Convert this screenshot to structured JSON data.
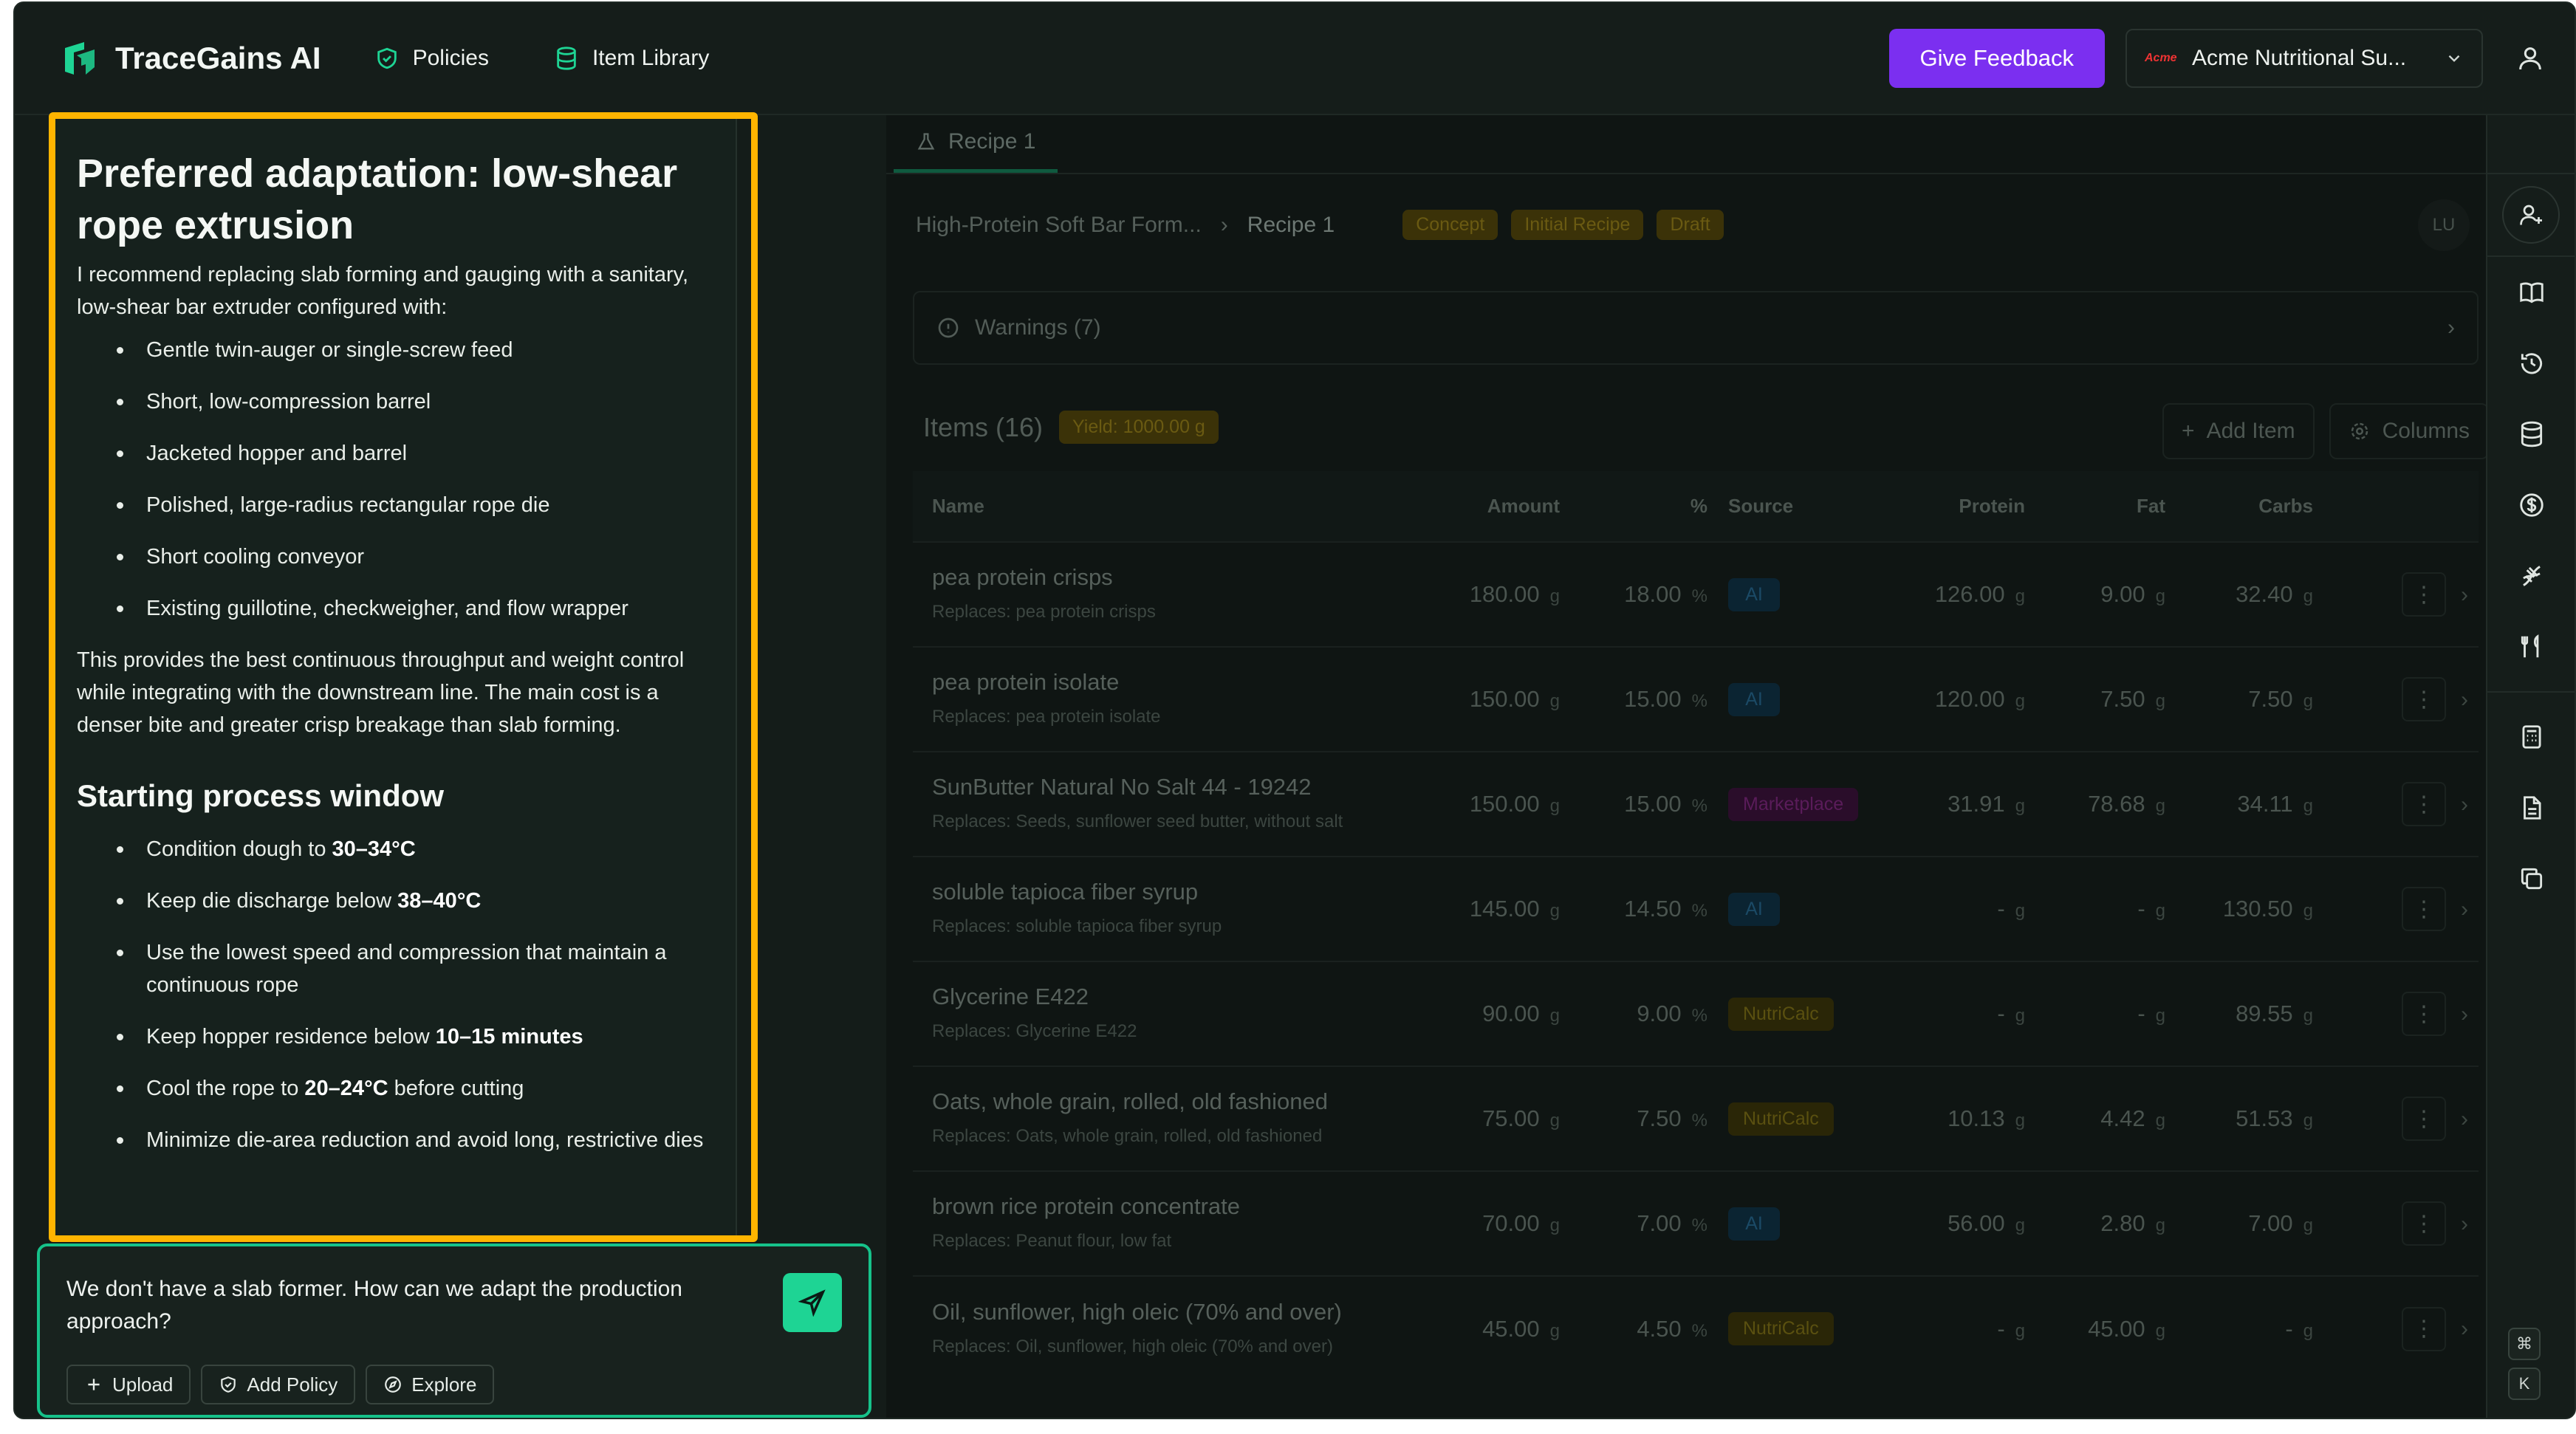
{
  "header": {
    "app_name": "TraceGains AI",
    "nav": [
      {
        "label": "Policies"
      },
      {
        "label": "Item Library"
      }
    ],
    "feedback_label": "Give Feedback",
    "org_logo_text": "Acme",
    "org_name": "Acme Nutritional Su..."
  },
  "chat": {
    "heading1": "Preferred adaptation: low-shear rope extrusion",
    "para1": "I recommend replacing slab forming and gauging with a sanitary, low-shear bar extruder configured with:",
    "bullets1": [
      "Gentle twin-auger or single-screw feed",
      "Short, low-compression barrel",
      "Jacketed hopper and barrel",
      "Polished, large-radius rectangular rope die",
      "Short cooling conveyor",
      "Existing guillotine, checkweigher, and flow wrapper"
    ],
    "para2": "This provides the best continuous throughput and weight control while integrating with the downstream line. The main cost is a denser bite and greater crisp breakage than slab forming.",
    "heading2": "Starting process window",
    "bullets2": [
      {
        "pre": "Condition dough to ",
        "bold": "30–34°C",
        "post": ""
      },
      {
        "pre": "Keep die discharge below ",
        "bold": "38–40°C",
        "post": ""
      },
      {
        "pre": "Use the lowest speed and compression that maintain a continuous rope",
        "bold": "",
        "post": ""
      },
      {
        "pre": "Keep hopper residence below ",
        "bold": "10–15 minutes",
        "post": ""
      },
      {
        "pre": "Cool the rope to ",
        "bold": "20–24°C",
        "post": " before cutting"
      },
      {
        "pre": "Minimize die-area reduction and avoid long, restrictive dies",
        "bold": "",
        "post": ""
      }
    ],
    "input_value": "We don't have a slab former. How can we adapt the production approach?",
    "tools": [
      "Upload",
      "Add Policy",
      "Explore"
    ]
  },
  "recipe": {
    "tab_label": "Recipe 1",
    "breadcrumb_parent": "High-Protein Soft Bar Form...",
    "breadcrumb_current": "Recipe 1",
    "badges": [
      "Concept",
      "Initial Recipe",
      "Draft"
    ],
    "avatar_initials": "LU",
    "warnings_label": "Warnings (7)",
    "items_label": "Items (16)",
    "yield_label": "Yield: 1000.00 g",
    "add_item_label": "Add Item",
    "columns_label": "Columns",
    "columns": [
      "Name",
      "Amount",
      "%",
      "Source",
      "Protein",
      "Fat",
      "Carbs"
    ],
    "rows": [
      {
        "name": "pea protein crisps",
        "replaces": "Replaces: pea protein crisps",
        "amount": "180.00",
        "pct": "18.00",
        "source": "AI",
        "src_type": "ai",
        "protein": "126.00",
        "fat": "9.00",
        "carbs": "32.40"
      },
      {
        "name": "pea protein isolate",
        "replaces": "Replaces: pea protein isolate",
        "amount": "150.00",
        "pct": "15.00",
        "source": "AI",
        "src_type": "ai",
        "protein": "120.00",
        "fat": "7.50",
        "carbs": "7.50"
      },
      {
        "name": "SunButter Natural No Salt 44 - 19242",
        "replaces": "Replaces: Seeds, sunflower seed butter, without salt",
        "amount": "150.00",
        "pct": "15.00",
        "source": "Marketplace",
        "src_type": "mk",
        "protein": "31.91",
        "fat": "78.68",
        "carbs": "34.11"
      },
      {
        "name": "soluble tapioca fiber syrup",
        "replaces": "Replaces: soluble tapioca fiber syrup",
        "amount": "145.00",
        "pct": "14.50",
        "source": "AI",
        "src_type": "ai",
        "protein": "-",
        "fat": "-",
        "carbs": "130.50"
      },
      {
        "name": "Glycerine E422",
        "replaces": "Replaces: Glycerine E422",
        "amount": "90.00",
        "pct": "9.00",
        "source": "NutriCalc",
        "src_type": "nc",
        "protein": "-",
        "fat": "-",
        "carbs": "89.55"
      },
      {
        "name": "Oats, whole grain, rolled, old fashioned",
        "replaces": "Replaces: Oats, whole grain, rolled, old fashioned",
        "amount": "75.00",
        "pct": "7.50",
        "source": "NutriCalc",
        "src_type": "nc",
        "protein": "10.13",
        "fat": "4.42",
        "carbs": "51.53"
      },
      {
        "name": "brown rice protein concentrate",
        "replaces": "Replaces: Peanut flour, low fat",
        "amount": "70.00",
        "pct": "7.00",
        "source": "AI",
        "src_type": "ai",
        "protein": "56.00",
        "fat": "2.80",
        "carbs": "7.00"
      },
      {
        "name": "Oil, sunflower, high oleic (70% and over)",
        "replaces": "Replaces: Oil, sunflower, high oleic (70% and over)",
        "amount": "45.00",
        "pct": "4.50",
        "source": "NutriCalc",
        "src_type": "nc",
        "protein": "-",
        "fat": "45.00",
        "carbs": "-"
      }
    ],
    "unit_g": "g",
    "unit_pct": "%"
  },
  "shortcut": {
    "key1": "⌘",
    "key2": "K"
  },
  "colors": {
    "accent_green": "#1ed494",
    "feedback_purple": "#7b2ff0",
    "highlight": "#ffb400"
  }
}
